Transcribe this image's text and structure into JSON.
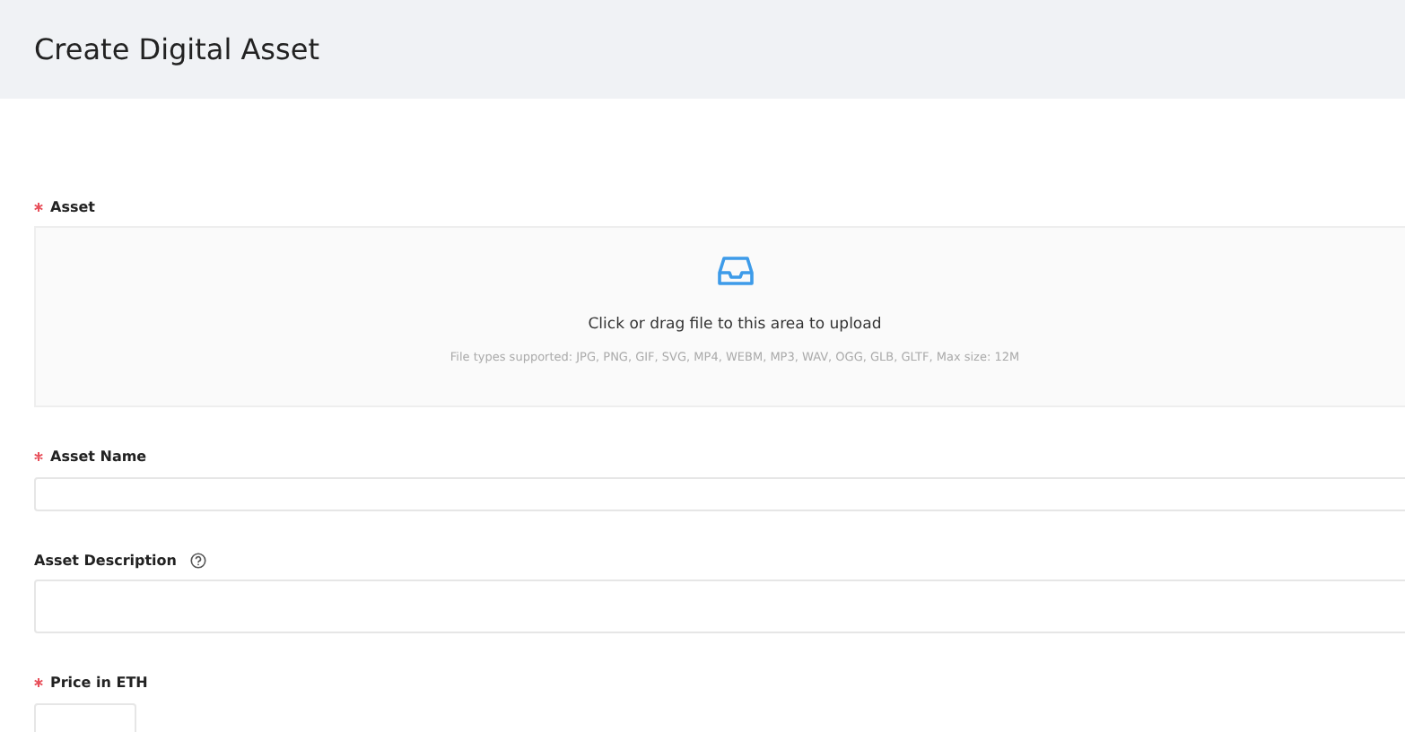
{
  "header": {
    "title": "Create Digital Asset"
  },
  "fields": [
    {
      "kind": "upload",
      "label": "Asset",
      "required": true,
      "help": false,
      "prompt": "Click or drag file to this area to upload",
      "hint": "File types supported: JPG, PNG, GIF, SVG, MP4, WEBM, MP3, WAV, OGG, GLB, GLTF, Max size: 12M"
    },
    {
      "kind": "input",
      "label": "Asset Name",
      "required": true,
      "help": false
    },
    {
      "kind": "textarea",
      "label": "Asset Description",
      "required": false,
      "help": true
    },
    {
      "kind": "small-input",
      "label": "Price in ETH",
      "required": true,
      "help": false
    }
  ]
}
